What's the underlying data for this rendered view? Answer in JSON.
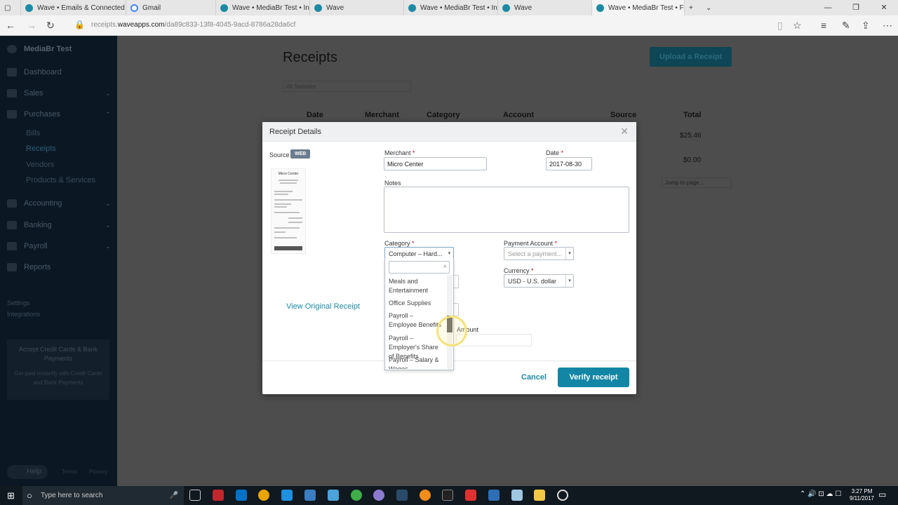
{
  "browser": {
    "tabs": [
      {
        "label": "Wave • Emails & Connected"
      },
      {
        "label": "Gmail"
      },
      {
        "label": "Wave • MediaBr Test • Invoi"
      },
      {
        "label": "Wave"
      },
      {
        "label": "Wave • MediaBr Test • Invoi"
      },
      {
        "label": "Wave"
      },
      {
        "label": "Wave • MediaBr Test • F"
      }
    ],
    "url_host": "receipts.waveapps.com",
    "url_path": "/da89c833-13f8-4045-9acd-8786a28da6cf",
    "url_prefix": "receipts.",
    "url_domain": "waveapps.com"
  },
  "sidebar": {
    "business": "MediaBr Test",
    "items": [
      {
        "label": "Dashboard"
      },
      {
        "label": "Sales"
      },
      {
        "label": "Purchases"
      },
      {
        "label": "Accounting"
      },
      {
        "label": "Banking"
      },
      {
        "label": "Payroll"
      },
      {
        "label": "Reports"
      }
    ],
    "purchases_sub": [
      "Bills",
      "Receipts",
      "Vendors",
      "Products & Services"
    ],
    "settings": "Settings",
    "integrations": "Integrations",
    "promo_title": "Accept Credit Cards & Bank Payments",
    "promo_text": "Get paid instantly with Credit Cards and Bank Payments",
    "help": "Help",
    "terms": "Terms",
    "privacy": "Privacy"
  },
  "page": {
    "title": "Receipts",
    "upload_button": "Upload a Receipt",
    "status_filter": "All Statuses",
    "columns": [
      "Date",
      "Merchant",
      "Category",
      "Account",
      "Source",
      "Total"
    ],
    "totals": [
      "$25.46",
      "$0.00"
    ],
    "jump": "Jump to page..."
  },
  "modal": {
    "title": "Receipt Details",
    "source_label": "Source",
    "source_badge": "WEB",
    "receipt_store": "Micro Center",
    "view_original": "View Original Receipt",
    "merchant_label": "Merchant",
    "merchant_value": "Micro Center",
    "date_label": "Date",
    "date_value": "2017-08-30",
    "notes_label": "Notes",
    "category_label": "Category",
    "category_value": "Computer – Hard...",
    "payment_label": "Payment Account",
    "payment_placeholder": "Select a payment...",
    "currency_label": "Currency",
    "currency_value": "USD - U.S. dollar",
    "amount_label": "Amount",
    "cancel": "Cancel",
    "verify": "Verify receipt",
    "dropdown_options": [
      "Meals and Entertainment",
      "Office Supplies",
      "Payroll – Employee Benefits",
      "Payroll – Employer's Share of Benefits",
      "Payroll – Salary & Wages"
    ]
  },
  "taskbar": {
    "search_placeholder": "Type here to search",
    "time": "3:27 PM",
    "date": "9/11/2017"
  }
}
